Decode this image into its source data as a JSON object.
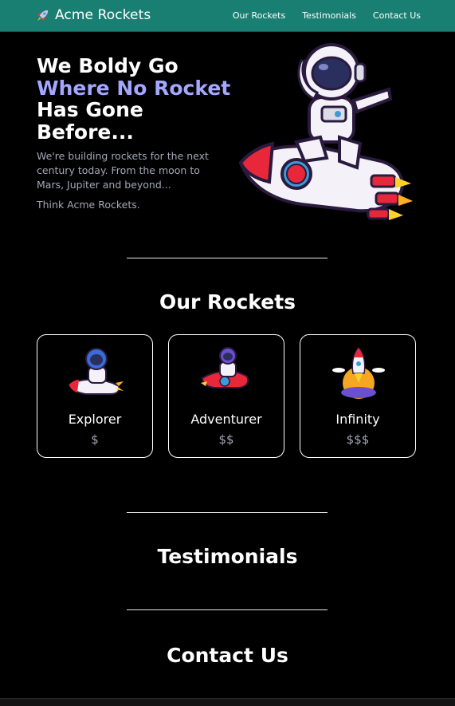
{
  "header": {
    "brand": "Acme Rockets",
    "nav": [
      "Our Rockets",
      "Testimonials",
      "Contact Us"
    ]
  },
  "hero": {
    "title_line1": "We Boldy Go",
    "title_accent": "Where No Rocket",
    "title_line3": "Has Gone",
    "title_line4": "Before...",
    "subtitle": "We're building rockets for the next century today. From the moon to Mars, Jupiter and beyond...",
    "tagline": "Think Acme Rockets."
  },
  "rockets": {
    "title": "Our Rockets",
    "cards": [
      {
        "name": "Explorer",
        "price": "$"
      },
      {
        "name": "Adventurer",
        "price": "$$"
      },
      {
        "name": "Infinity",
        "price": "$$$"
      }
    ]
  },
  "testimonials": {
    "title": "Testimonials"
  },
  "contact": {
    "title": "Contact Us"
  },
  "colors": {
    "header_bg": "#1a7f73",
    "accent": "#a4a7ff",
    "muted": "#a4a8b8"
  },
  "icons": [
    "rocket-icon",
    "astronaut-on-rocket-illustration",
    "astronaut-riding-rocket-illustration",
    "rocket-launch-illustration"
  ]
}
